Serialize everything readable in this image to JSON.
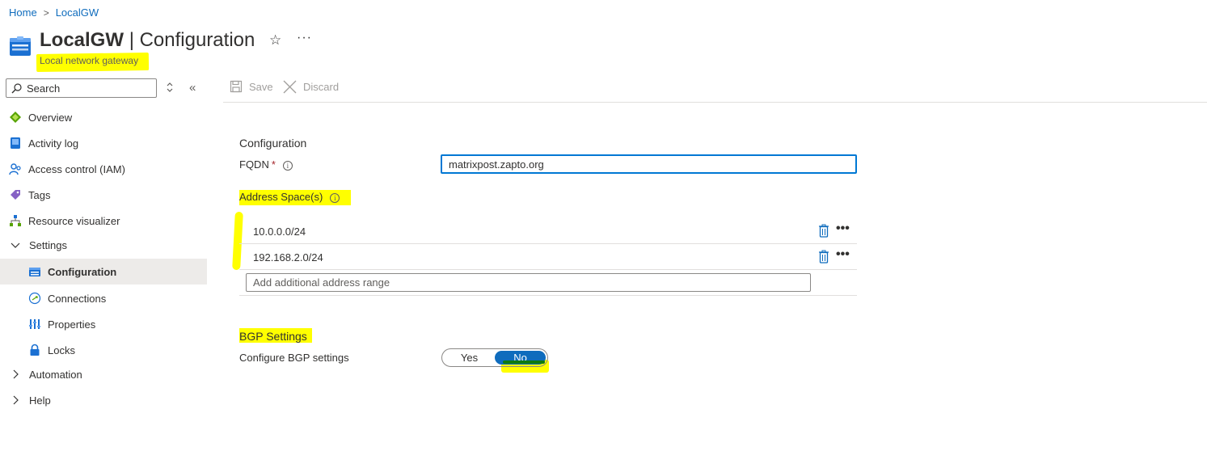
{
  "breadcrumb": {
    "home": "Home",
    "resource": "LocalGW"
  },
  "header": {
    "resource_name": "LocalGW",
    "separator": "|",
    "page_name": "Configuration",
    "subtitle": "Local network gateway",
    "favorite_icon": "star-icon",
    "more_icon": "ellipsis-icon"
  },
  "search": {
    "placeholder": "Search"
  },
  "sidebar": {
    "items": [
      {
        "label": "Overview",
        "icon": "overview-icon"
      },
      {
        "label": "Activity log",
        "icon": "activity-log-icon"
      },
      {
        "label": "Access control (IAM)",
        "icon": "iam-icon"
      },
      {
        "label": "Tags",
        "icon": "tag-icon"
      },
      {
        "label": "Resource visualizer",
        "icon": "visualizer-icon"
      },
      {
        "label": "Settings",
        "icon": "chevron-down-icon",
        "expanded": true
      },
      {
        "label": "Configuration",
        "icon": "gateway-icon",
        "selected": true
      },
      {
        "label": "Connections",
        "icon": "connections-icon"
      },
      {
        "label": "Properties",
        "icon": "properties-icon"
      },
      {
        "label": "Locks",
        "icon": "lock-icon"
      },
      {
        "label": "Automation",
        "icon": "chevron-right-icon"
      },
      {
        "label": "Help",
        "icon": "chevron-right-icon"
      }
    ]
  },
  "toolbar": {
    "save_label": "Save",
    "discard_label": "Discard"
  },
  "form": {
    "section_title": "Configuration",
    "fqdn_label": "FQDN",
    "required_mark": "*",
    "fqdn_value": "matrixpost.zapto.org",
    "address_space_label": "Address Space(s)",
    "address_spaces": [
      "10.0.0.0/24",
      "192.168.2.0/24"
    ],
    "address_placeholder": "Add additional address range",
    "bgp_title": "BGP Settings",
    "bgp_label": "Configure BGP settings",
    "bgp_options": [
      "Yes",
      "No"
    ],
    "bgp_selected": "No"
  },
  "colors": {
    "accent": "#0f6cbd",
    "highlight": "#ffff00",
    "selected_bg": "#edebe9"
  }
}
